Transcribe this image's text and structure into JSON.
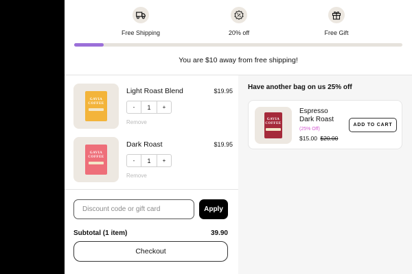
{
  "rewards": {
    "items": [
      {
        "label": "Free Shipping",
        "icon": "truck-icon"
      },
      {
        "label": "20% off",
        "icon": "discount-badge-icon"
      },
      {
        "label": "Free Gift",
        "icon": "gift-icon"
      }
    ],
    "progress_fraction": 0.09,
    "progress_color": "#9b6fd9",
    "message": "You are $10 away from free shipping!"
  },
  "cart": {
    "items": [
      {
        "name": "Light Roast Blend",
        "price": "$19.95",
        "quantity": "1",
        "decrement": "-",
        "increment": "+",
        "remove": "Remove",
        "brand": "GAVIA COFFEE",
        "bag_color": "#f3b43a"
      },
      {
        "name": "Dark Roast",
        "price": "$19.95",
        "quantity": "1",
        "decrement": "-",
        "increment": "+",
        "remove": "Remove",
        "brand": "GAVIA COFFEE",
        "bag_color": "#ee6f7a"
      }
    ],
    "discount_placeholder": "Discount code or gift card",
    "apply_label": "Apply",
    "subtotal_label": "Subtotal (1 item)",
    "subtotal_value": "39.90",
    "checkout_label": "Checkout"
  },
  "upsell": {
    "title": "Have another bag on us 25% off",
    "product": {
      "name_line1": "Espresso",
      "name_line2": "Dark Roast",
      "discount": "(25% Off)",
      "price": "$15.00",
      "original_price": "$20.00",
      "add_label": "ADD TO CART",
      "brand": "GAVIA COFFEE",
      "bag_color": "#a52a3a"
    }
  }
}
